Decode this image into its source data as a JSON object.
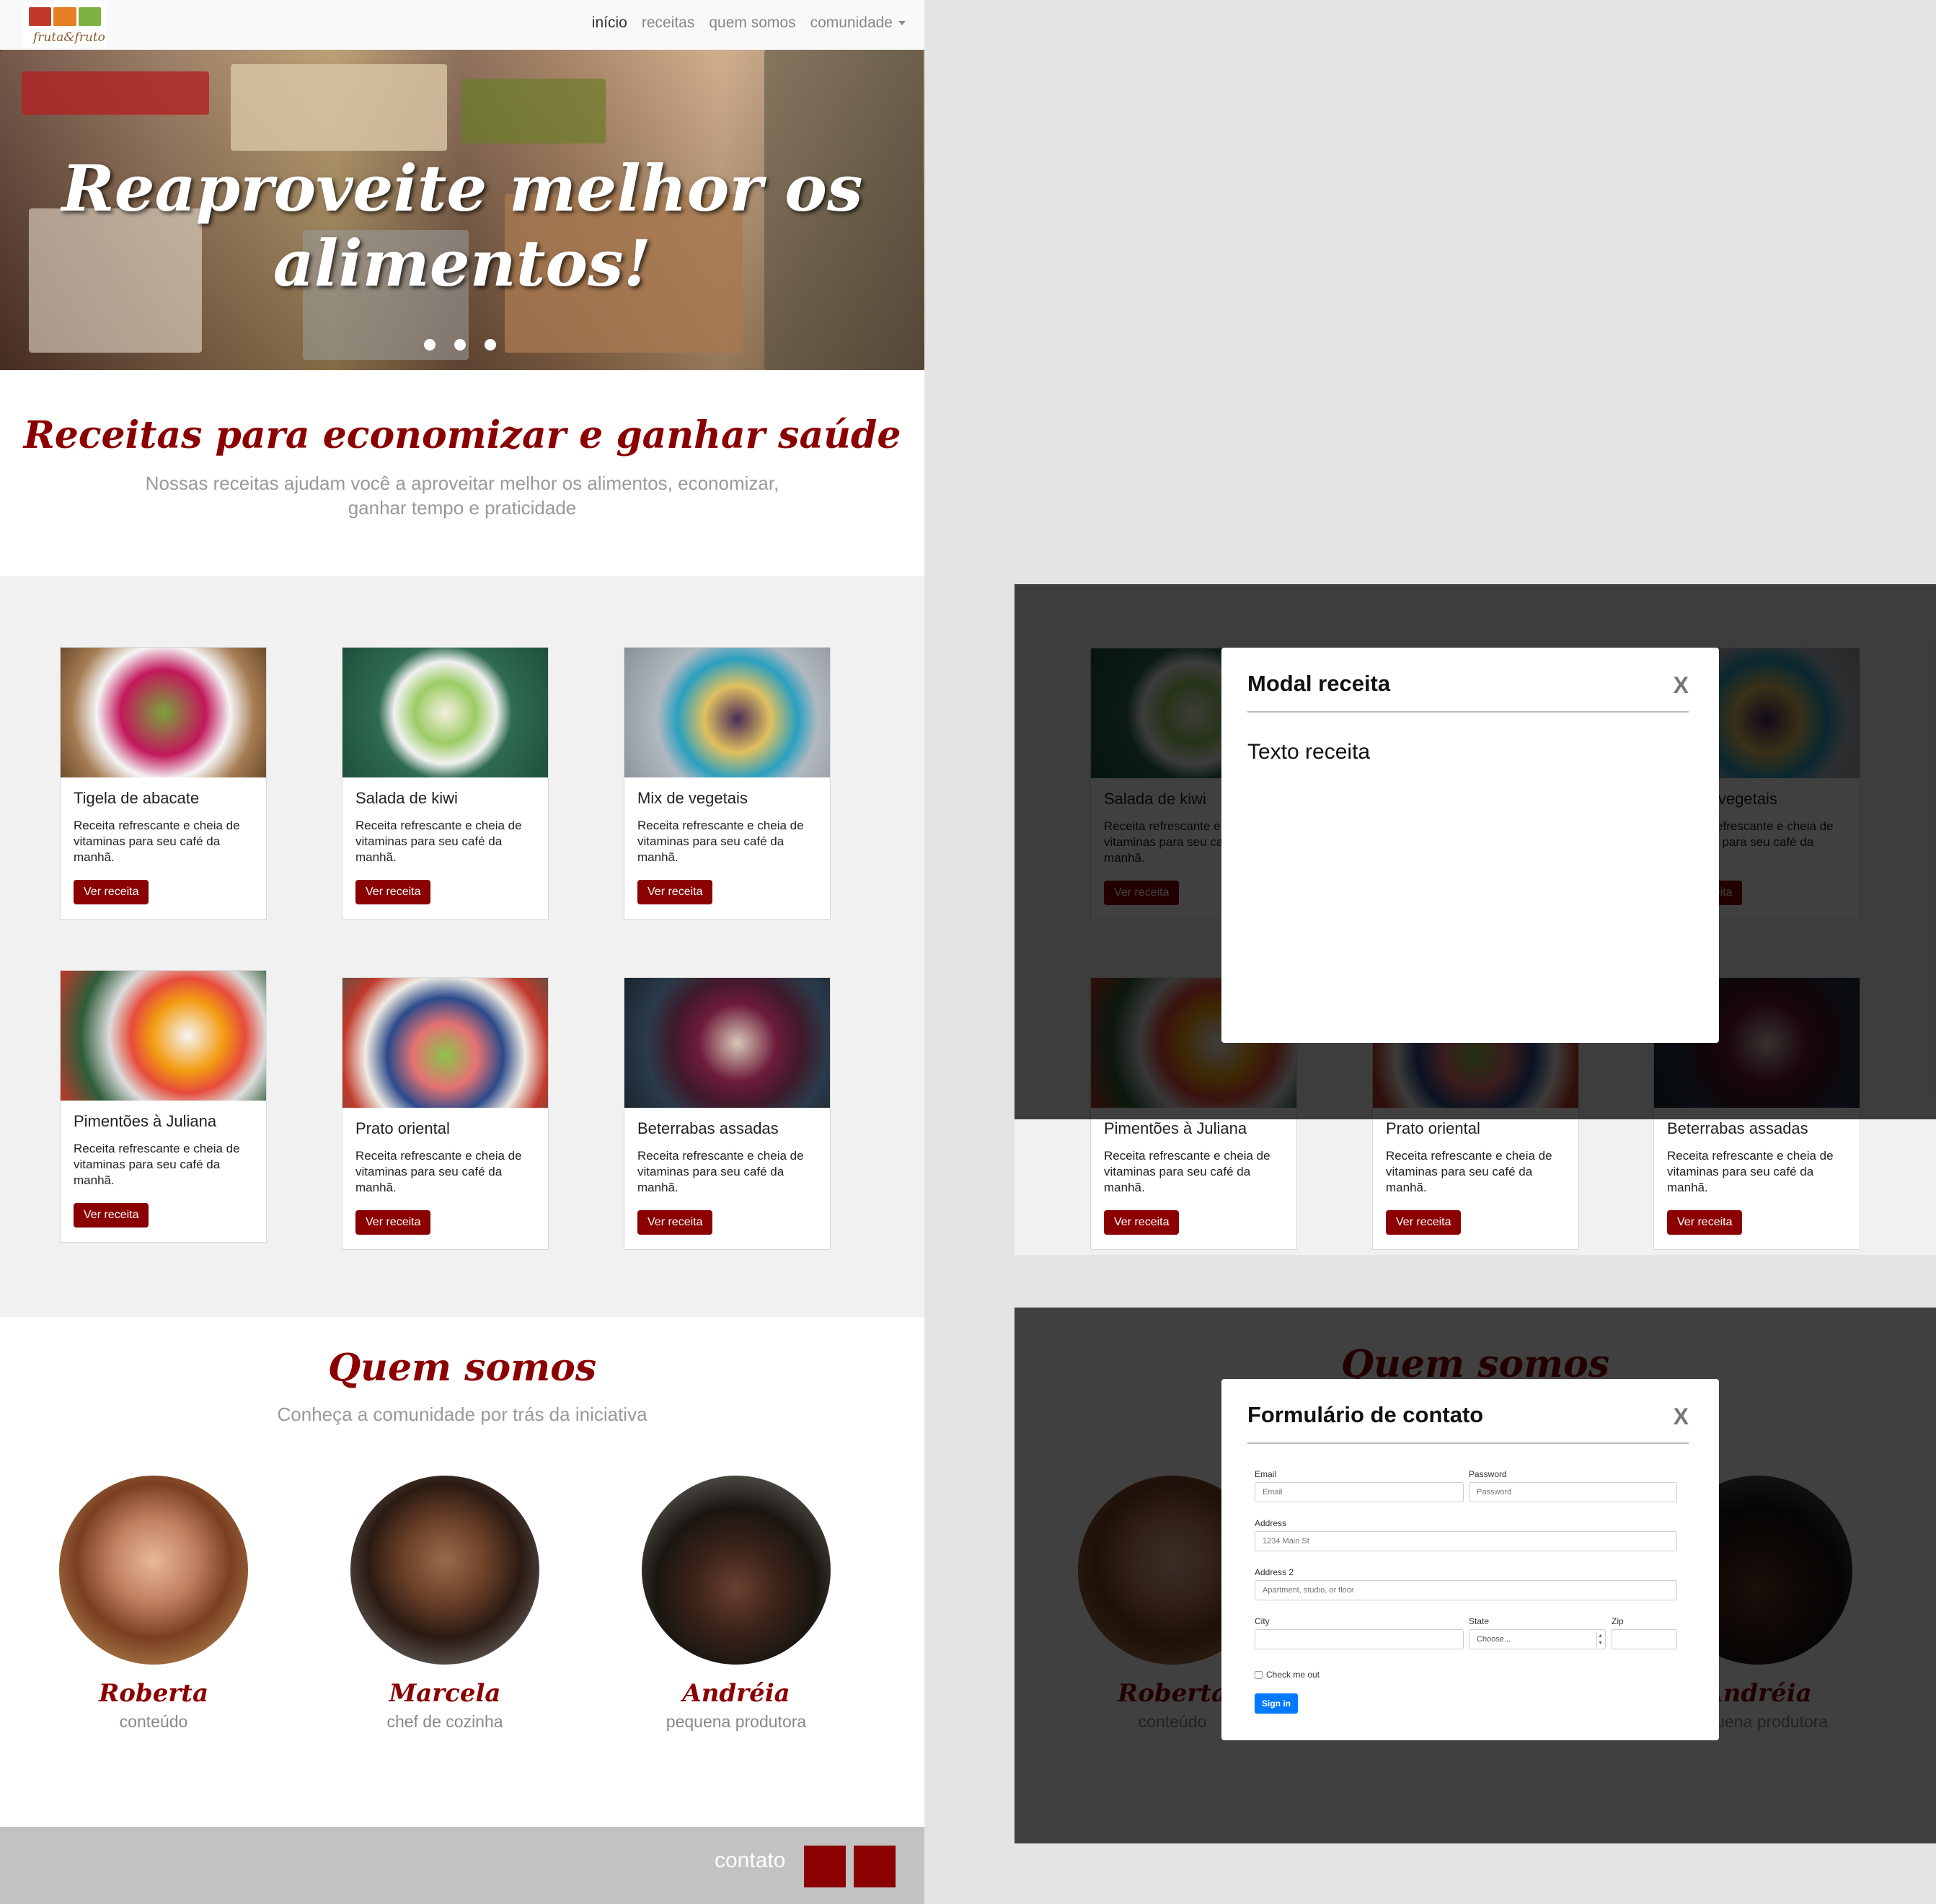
{
  "nav": {
    "logo_text": "fruta&fruto",
    "links": [
      "início",
      "receitas",
      "quem somos",
      "comunidade"
    ]
  },
  "hero": {
    "title": "Reaproveite melhor os alimentos!"
  },
  "intro": {
    "title": "Receitas para economizar e ganhar saúde",
    "subtitle": "Nossas receitas ajudam você a aproveitar melhor os alimentos, economizar, ganhar tempo e praticidade"
  },
  "recipes": [
    {
      "title": "Tigela de abacate",
      "desc": "Receita refrescante e cheia de vitaminas para seu café da manhã.",
      "button": "Ver receita"
    },
    {
      "title": "Salada de kiwi",
      "desc": "Receita refrescante e cheia de vitaminas para seu café da manhã.",
      "button": "Ver receita"
    },
    {
      "title": "Mix de vegetais",
      "desc": "Receita refrescante e cheia de vitaminas para seu café da manhã.",
      "button": "Ver receita"
    },
    {
      "title": "Pimentões à Juliana",
      "desc": "Receita refrescante e cheia de vitaminas para seu café da manhã.",
      "button": "Ver receita"
    },
    {
      "title": "Prato oriental",
      "desc": "Receita refrescante e cheia de vitaminas para seu café da manhã.",
      "button": "Ver receita"
    },
    {
      "title": "Beterrabas assadas",
      "desc": "Receita refrescante e cheia de vitaminas para seu café da manhã.",
      "button": "Ver receita"
    }
  ],
  "about": {
    "title": "Quem somos",
    "subtitle": "Conheça a comunidade por trás da iniciativa",
    "people": [
      {
        "name": "Roberta",
        "role": "conteúdo"
      },
      {
        "name": "Marcela",
        "role": "chef de cozinha"
      },
      {
        "name": "Andréia",
        "role": "pequena produtora"
      }
    ]
  },
  "footer": {
    "label": "contato"
  },
  "modal_recipe": {
    "title": "Modal receita",
    "close": "X",
    "body": "Texto receita"
  },
  "modal_contact": {
    "title": "Formulário de contato",
    "close": "X",
    "email_label": "Email",
    "email_placeholder": "Email",
    "password_label": "Password",
    "password_placeholder": "Password",
    "address_label": "Address",
    "address_placeholder": "1234 Main St",
    "address2_label": "Address 2",
    "address2_placeholder": "Apartment, studio, or floor",
    "city_label": "City",
    "state_label": "State",
    "state_selected": "Choose...",
    "zip_label": "Zip",
    "checkbox_label": "Check me out",
    "submit": "Sign in"
  },
  "colors": {
    "brand": "#8b0000",
    "navbar_bg": "#f8f9fa",
    "section_bg": "#f1f1f1",
    "footer_bg": "#c2c2c2",
    "overlay": "rgba(0,0,0,0.75)",
    "primary_button": "#007bff"
  }
}
